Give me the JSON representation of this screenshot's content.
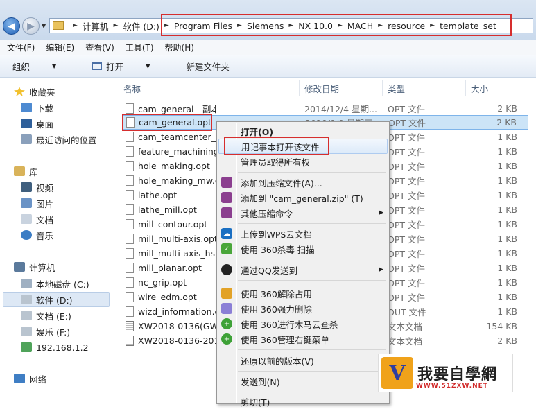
{
  "address": {
    "crumbs": [
      "计算机",
      "软件 (D:)",
      "Program Files",
      "Siemens",
      "NX 10.0",
      "MACH",
      "resource",
      "template_set"
    ]
  },
  "menu": [
    "文件(F)",
    "编辑(E)",
    "查看(V)",
    "工具(T)",
    "帮助(H)"
  ],
  "toolbar": {
    "organize": "组织",
    "open": "打开",
    "new_folder": "新建文件夹"
  },
  "sidebar": {
    "favorites": "收藏夹",
    "fav_items": [
      "下载",
      "桌面",
      "最近访问的位置"
    ],
    "libraries": "库",
    "lib_items": [
      "视频",
      "图片",
      "文档",
      "音乐"
    ],
    "computer": "计算机",
    "drives": [
      "本地磁盘 (C:)",
      "软件 (D:)",
      "文档 (E:)",
      "娱乐 (F:)",
      "192.168.1.2"
    ],
    "network": "网络"
  },
  "columns": {
    "name": "名称",
    "date": "修改日期",
    "type": "类型",
    "size": "大小"
  },
  "files": [
    {
      "name": "cam_general - 副本.opt",
      "date": "2014/12/4 星期...",
      "type": "OPT 文件",
      "size": "2 KB"
    },
    {
      "name": "cam_general.opt",
      "date": "2010/9/9 星期三...",
      "type": "OPT 文件",
      "size": "2 KB"
    },
    {
      "name": "cam_teamcenter_general.opt",
      "date": "",
      "type": "OPT 文件",
      "size": "1 KB"
    },
    {
      "name": "feature_machining.opt",
      "date": "",
      "type": "OPT 文件",
      "size": "1 KB"
    },
    {
      "name": "hole_making.opt",
      "date": "",
      "type": "OPT 文件",
      "size": "1 KB"
    },
    {
      "name": "hole_making_mw.opt",
      "date": "",
      "type": "OPT 文件",
      "size": "1 KB"
    },
    {
      "name": "lathe.opt",
      "date": "",
      "type": "OPT 文件",
      "size": "1 KB"
    },
    {
      "name": "lathe_mill.opt",
      "date": "",
      "type": "OPT 文件",
      "size": "1 KB"
    },
    {
      "name": "mill_contour.opt",
      "date": "",
      "type": "OPT 文件",
      "size": "1 KB"
    },
    {
      "name": "mill_multi-axis.opt",
      "date": "",
      "type": "OPT 文件",
      "size": "1 KB"
    },
    {
      "name": "mill_multi-axis_hsm.opt",
      "date": "",
      "type": "OPT 文件",
      "size": "1 KB"
    },
    {
      "name": "mill_planar.opt",
      "date": "",
      "type": "OPT 文件",
      "size": "1 KB"
    },
    {
      "name": "nc_grip.opt",
      "date": "",
      "type": "OPT 文件",
      "size": "1 KB"
    },
    {
      "name": "wire_edm.opt",
      "date": "",
      "type": "OPT 文件",
      "size": "1 KB"
    },
    {
      "name": "wizd_information.out",
      "date": "",
      "type": "OUT 文件",
      "size": "1 KB"
    },
    {
      "name": "XW2018-0136(GW1",
      "date": "",
      "type": "文本文档",
      "size": "154 KB"
    },
    {
      "name": "XW2018-0136-2018",
      "date": "",
      "type": "文本文档",
      "size": "2 KB"
    }
  ],
  "context_menu": [
    "打开(O)",
    "用记事本打开该文件",
    "管理员取得所有权",
    "添加到压缩文件(A)...",
    "添加到 \"cam_general.zip\" (T)",
    "其他压缩命令",
    "上传到WPS云文档",
    "使用 360杀毒 扫描",
    "通过QQ发送到",
    "使用 360解除占用",
    "使用 360强力删除",
    "使用 360进行木马云查杀",
    "使用 360管理右键菜单",
    "还原以前的版本(V)",
    "发送到(N)",
    "剪切(T)"
  ],
  "watermark": {
    "title": "我要自學網",
    "url": "WWW.51ZXW.NET"
  },
  "colors": {
    "highlight_box": "#d62e2e",
    "selection": "#cce4f7"
  }
}
